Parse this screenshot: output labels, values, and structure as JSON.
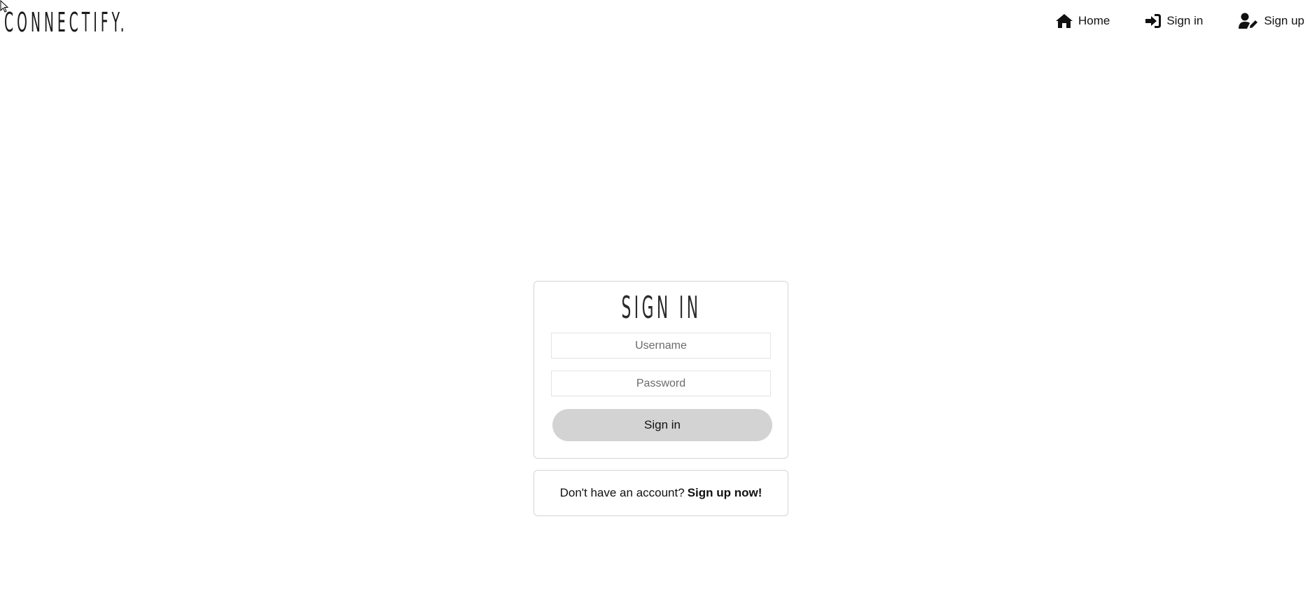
{
  "brand": {
    "name": "CONNECTIFY."
  },
  "nav": {
    "items": [
      {
        "label": "Home",
        "icon": "home-icon"
      },
      {
        "label": "Sign in",
        "icon": "sign-in-icon"
      },
      {
        "label": "Sign up",
        "icon": "user-edit-icon"
      }
    ]
  },
  "signin": {
    "title": "SIGN IN",
    "username_placeholder": "Username",
    "password_placeholder": "Password",
    "username_value": "",
    "password_value": "",
    "submit_label": "Sign in"
  },
  "signup_prompt": {
    "text": "Don't have an account?",
    "link_label": "Sign up now!"
  },
  "colors": {
    "button_bg": "#d3d3d3",
    "card_border": "#d5d5d5",
    "text": "#111111"
  }
}
